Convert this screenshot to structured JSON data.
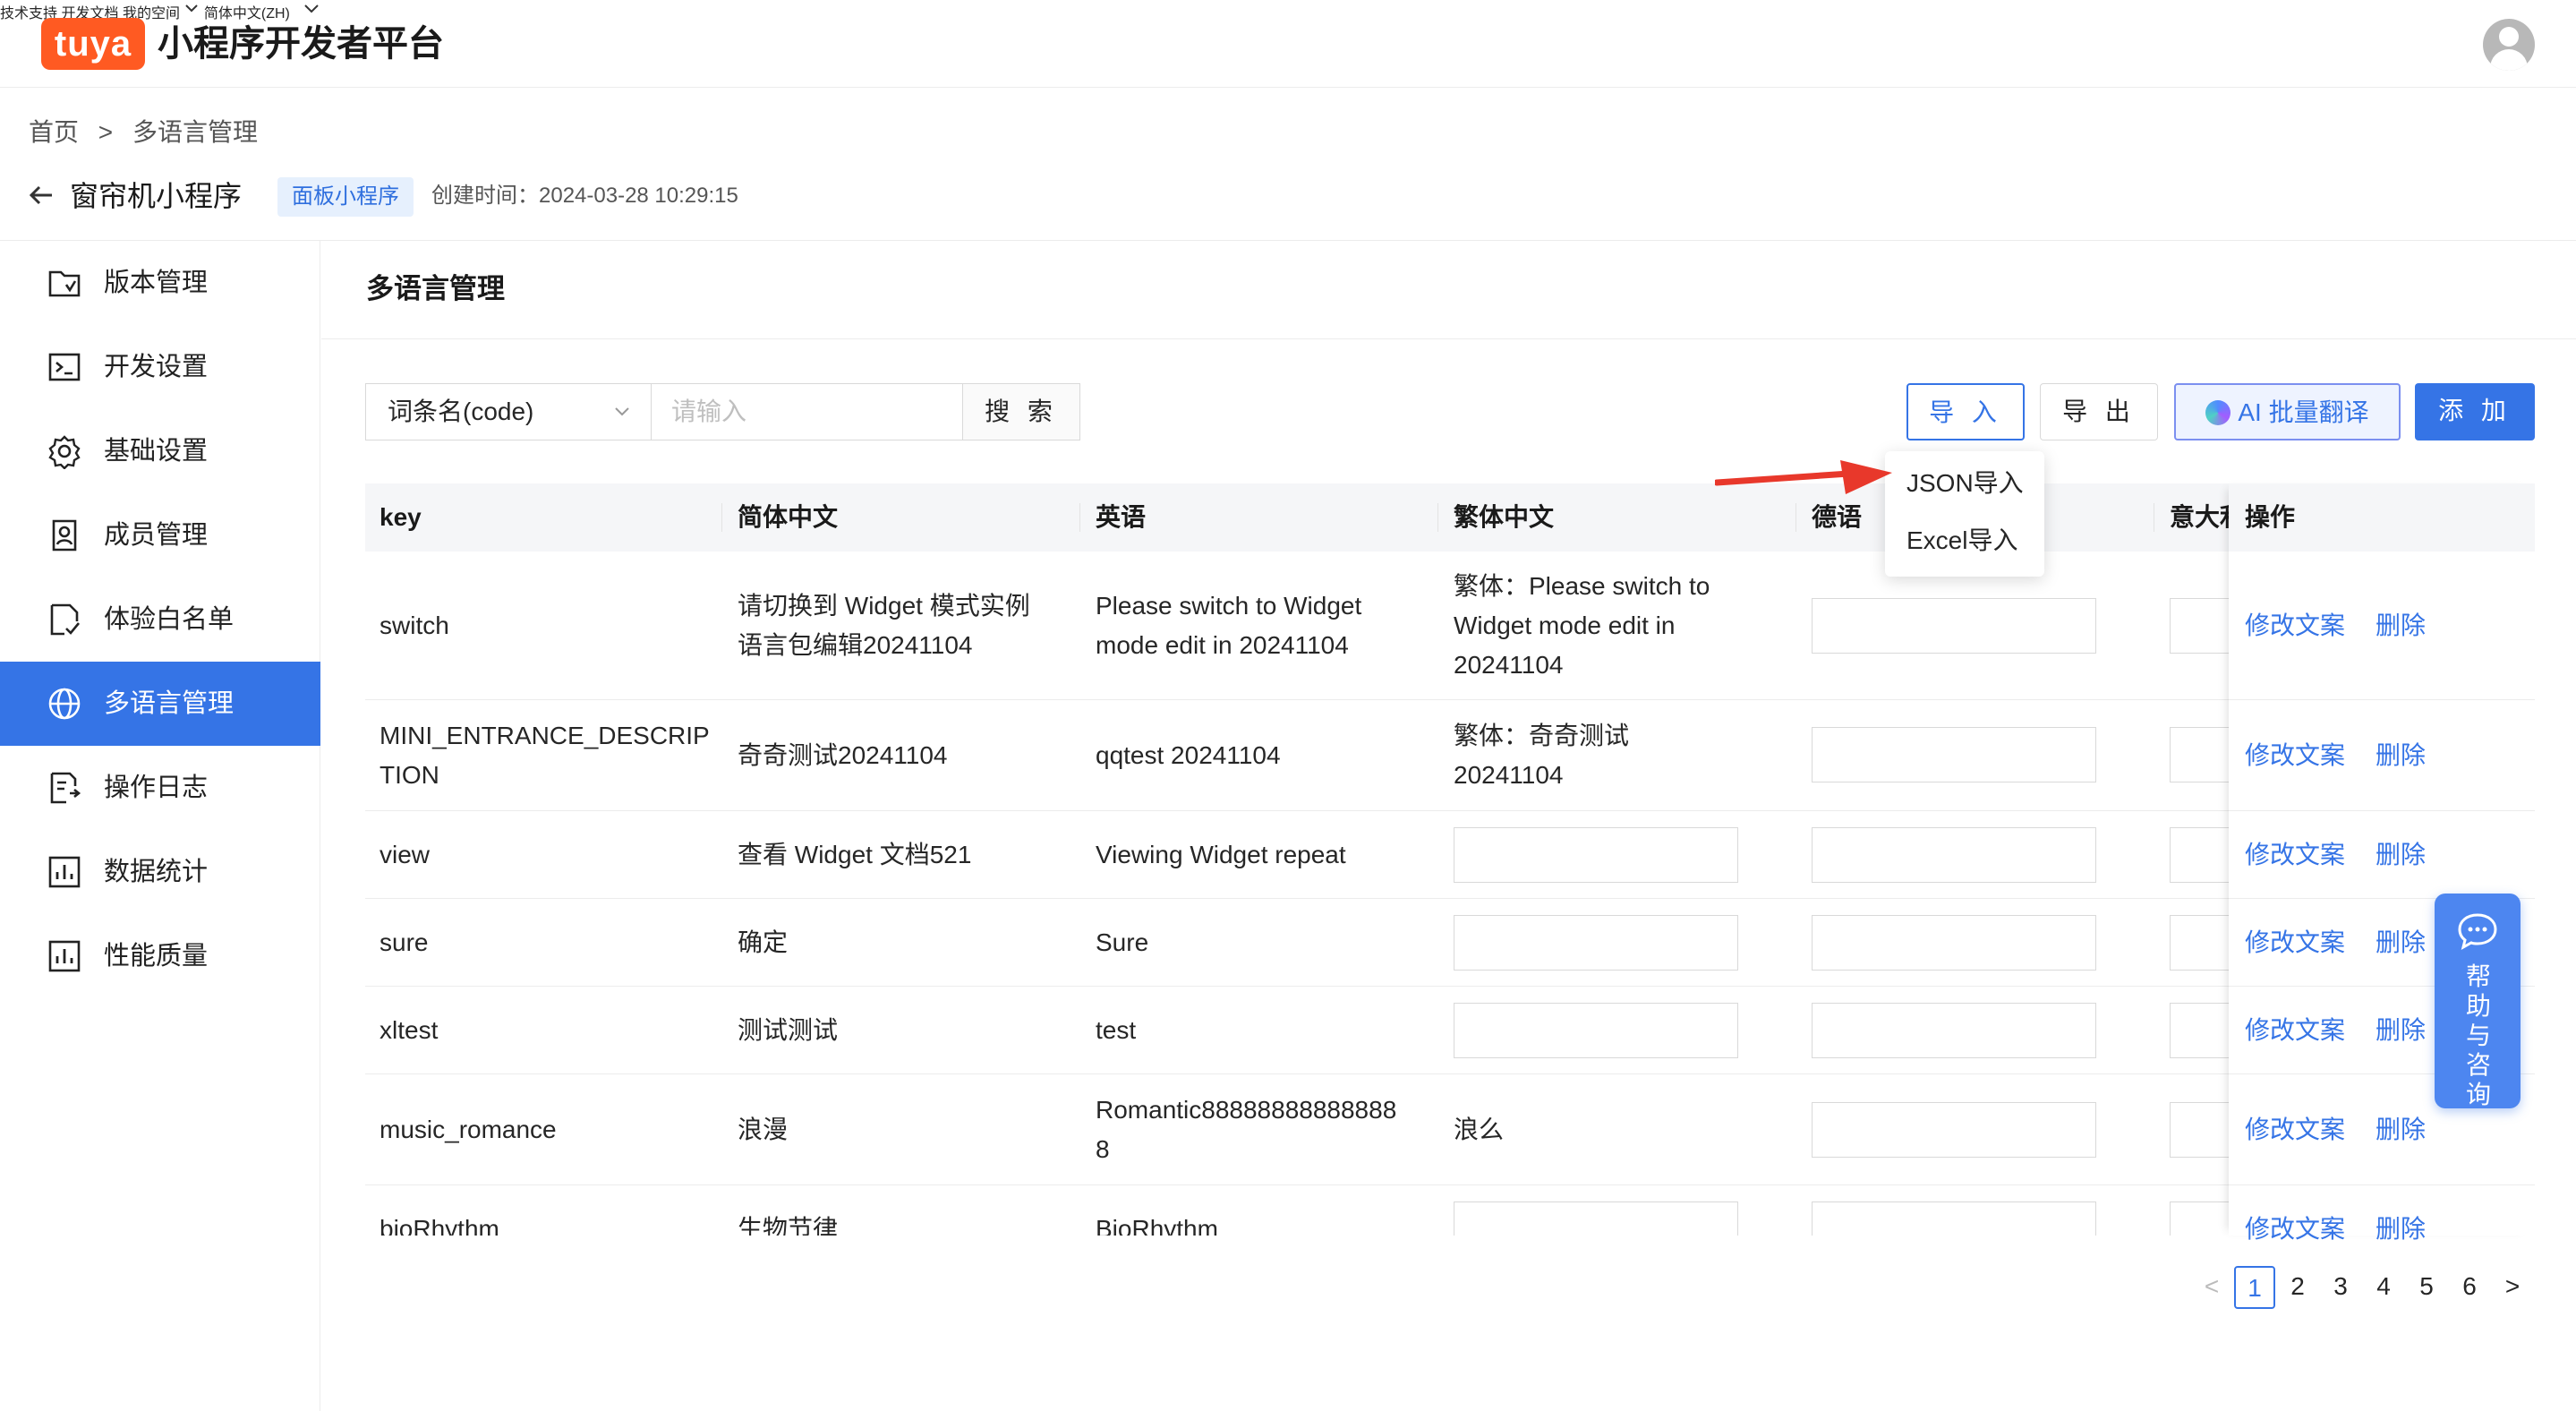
{
  "header": {
    "logo_text": "tuya",
    "platform_title": "小程序开发者平台",
    "nav": [
      "技术支持",
      "开发文档",
      "我的空间",
      "简体中文(ZH)"
    ]
  },
  "breadcrumb": [
    "首页",
    ">",
    "多语言管理"
  ],
  "project": {
    "name": "窗帘机小程序",
    "tag": "面板小程序",
    "created": "创建时间：2024-03-28 10:29:15"
  },
  "sidebar": {
    "items": [
      {
        "label": "版本管理",
        "icon": "folder-check-icon"
      },
      {
        "label": "开发设置",
        "icon": "terminal-icon"
      },
      {
        "label": "基础设置",
        "icon": "gear-icon"
      },
      {
        "label": "成员管理",
        "icon": "member-card-icon"
      },
      {
        "label": "体验白名单",
        "icon": "doc-check-icon"
      },
      {
        "label": "多语言管理",
        "icon": "globe-icon"
      },
      {
        "label": "操作日志",
        "icon": "log-icon"
      },
      {
        "label": "数据统计",
        "icon": "bar-chart-icon"
      },
      {
        "label": "性能质量",
        "icon": "bar-chart-icon"
      }
    ],
    "active_index": 5
  },
  "main": {
    "title": "多语言管理",
    "search": {
      "field_select": "词条名(code)",
      "placeholder": "请输入",
      "button": "搜 索"
    },
    "buttons": {
      "import": "导 入",
      "export": "导 出",
      "ai_translate": "AI 批量翻译",
      "add": "添 加"
    },
    "import_menu": [
      "JSON导入",
      "Excel导入"
    ]
  },
  "table": {
    "columns": [
      "key",
      "简体中文",
      "英语",
      "繁体中文",
      "德语",
      "意大利",
      "操作"
    ],
    "rows": [
      {
        "key": "switch",
        "zh": "请切换到 Widget 模式实例语言包编辑20241104",
        "en": "Please switch to Widget mode edit in 20241104",
        "zht": "繁体：Please switch to Widget mode edit in 20241104"
      },
      {
        "key": "MINI_ENTRANCE_DESCRIPTION",
        "zh": "奇奇测试20241104",
        "en": "qqtest 20241104",
        "zht": "繁体：奇奇测试20241104"
      },
      {
        "key": "view",
        "zh": "查看 Widget 文档521",
        "en": "Viewing Widget repeat",
        "zht": ""
      },
      {
        "key": "sure",
        "zh": "确定",
        "en": "Sure",
        "zht": ""
      },
      {
        "key": "xltest",
        "zh": "测试测试",
        "en": "test",
        "zht": ""
      },
      {
        "key": "music_romance",
        "zh": "浪漫",
        "en": "Romantic888888888888888",
        "zht": "浪么"
      },
      {
        "key": "bioRhythm",
        "zh": "生物节律",
        "en": "BioRhythm",
        "zht": ""
      }
    ],
    "actions": {
      "edit": "修改文案",
      "delete": "删除"
    }
  },
  "pagination": {
    "pages": [
      "1",
      "2",
      "3",
      "4",
      "5",
      "6"
    ],
    "current": "1",
    "prev": "<",
    "next": ">"
  },
  "help_float": {
    "label": "帮助与咨询"
  },
  "colors": {
    "primary": "#3574e6",
    "logo": "#ff5a22",
    "annotation_arrow": "#e8382b"
  }
}
